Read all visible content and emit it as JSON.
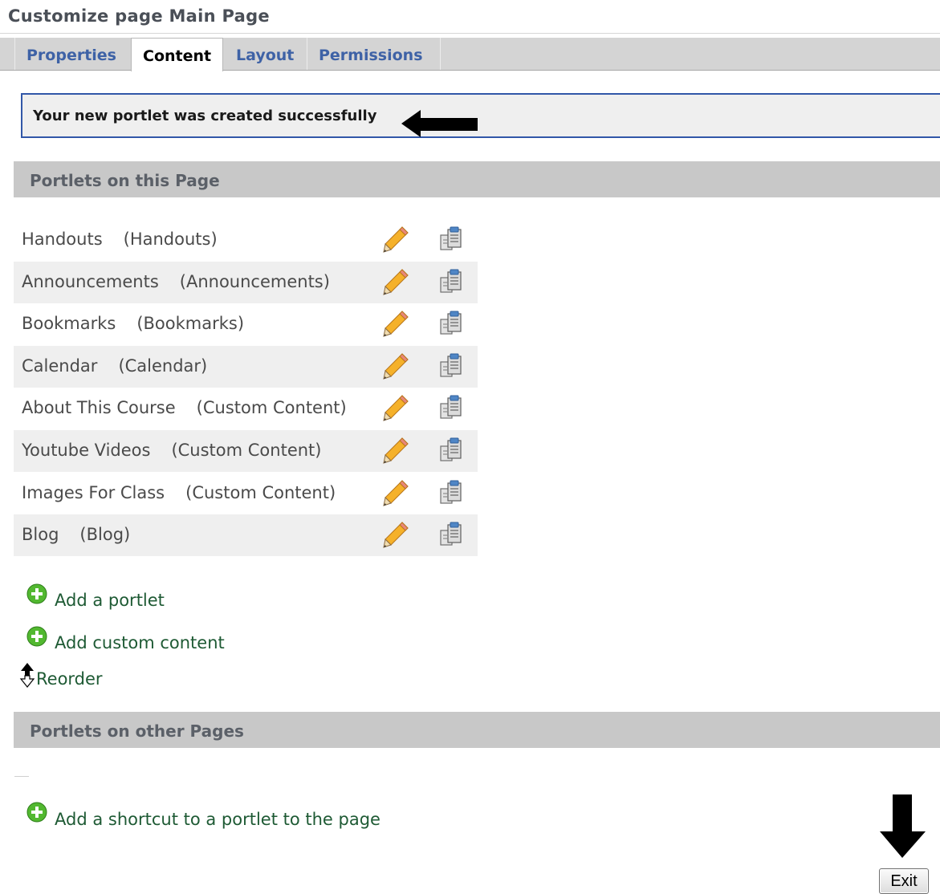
{
  "page": {
    "title": "Customize page Main Page"
  },
  "tabs": [
    {
      "label": "Properties",
      "active": false
    },
    {
      "label": "Content",
      "active": true
    },
    {
      "label": "Layout",
      "active": false
    },
    {
      "label": "Permissions",
      "active": false
    }
  ],
  "status_message": "Your new portlet was created successfully",
  "sections": {
    "this_page": "Portlets on this Page",
    "other_pages": "Portlets on other Pages"
  },
  "portlets": [
    {
      "name": "Handouts",
      "type": "(Handouts)"
    },
    {
      "name": "Announcements",
      "type": "(Announcements)"
    },
    {
      "name": "Bookmarks",
      "type": "(Bookmarks)"
    },
    {
      "name": "Calendar",
      "type": "(Calendar)"
    },
    {
      "name": "About This Course",
      "type": "(Custom Content)"
    },
    {
      "name": "Youtube Videos",
      "type": "(Custom Content)"
    },
    {
      "name": "Images For Class",
      "type": "(Custom Content)"
    },
    {
      "name": "Blog",
      "type": "(Blog)"
    }
  ],
  "actions": {
    "add_portlet": "Add a portlet",
    "add_custom_content": "Add custom content",
    "reorder": "Reorder",
    "add_shortcut": "Add a shortcut to a portlet to the page"
  },
  "exit_button": "Exit",
  "colors": {
    "tab_link": "#3e62a6",
    "action_link": "#1e5a34",
    "message_border": "#3157a8",
    "section_header_bg": "#c8c8c8"
  },
  "icons": {
    "edit": "pencil-icon",
    "copy": "copy-icon",
    "add": "plus-circle-icon",
    "reorder": "reorder-arrows-icon",
    "annotation": "arrow-icon"
  }
}
